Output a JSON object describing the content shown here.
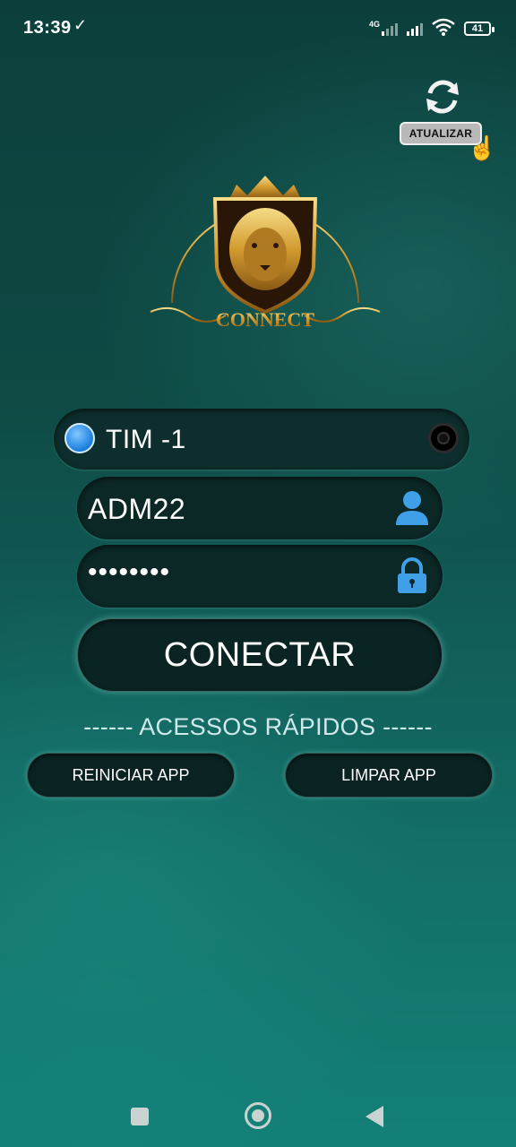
{
  "status_bar": {
    "time": "13:39",
    "network_type": "4G",
    "battery": "41"
  },
  "update": {
    "label": "ATUALIZAR",
    "icon": "refresh-icon"
  },
  "logo": {
    "text": "CONNECT"
  },
  "server": {
    "selected": "TIM -1"
  },
  "login": {
    "username_value": "ADM22",
    "password_value": "••••••••",
    "user_icon": "user-icon",
    "lock_icon": "lock-icon"
  },
  "connect_button": {
    "label": "CONECTAR"
  },
  "quick_access": {
    "title": "------ ACESSOS RÁPIDOS ------",
    "restart_label": "REINICIAR APP",
    "clear_label": "LIMPAR APP"
  },
  "colors": {
    "background": "#0f4a45",
    "accent_blue": "#2a8ee6",
    "gold": "#d9a93a"
  }
}
